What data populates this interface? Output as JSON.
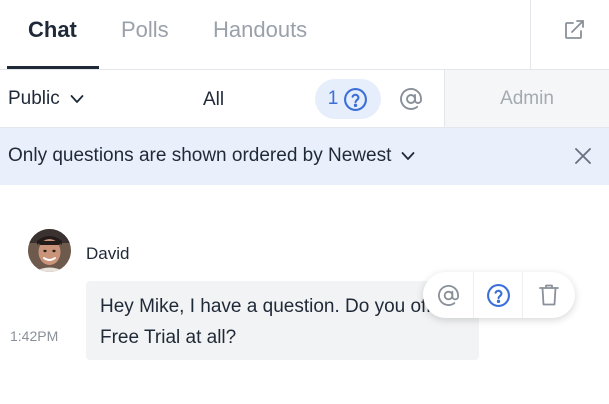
{
  "tabs": {
    "items": [
      {
        "label": "Chat",
        "active": true
      },
      {
        "label": "Polls",
        "active": false
      },
      {
        "label": "Handouts",
        "active": false
      }
    ],
    "popout_icon": "external-link-icon"
  },
  "filterbar": {
    "audience_label": "Public",
    "all_label": "All",
    "question_count": "1",
    "question_icon": "question-circle-icon",
    "mention_icon": "at-sign-icon",
    "admin_label": "Admin"
  },
  "notice": {
    "text": "Only questions are shown ordered by Newest",
    "close_icon": "close-icon"
  },
  "message": {
    "sender": "David",
    "time": "1:42PM",
    "text": "Hey Mike, I have a question. Do you offer a Free Trial at all?"
  },
  "actions": [
    "mention",
    "mark-question",
    "delete"
  ],
  "colors": {
    "accent": "#3b6fd8",
    "accent_bg": "#e6eefb",
    "notice_bg": "#eaf0fb",
    "bubble_bg": "#f2f3f4",
    "muted": "#9aa1aa"
  }
}
